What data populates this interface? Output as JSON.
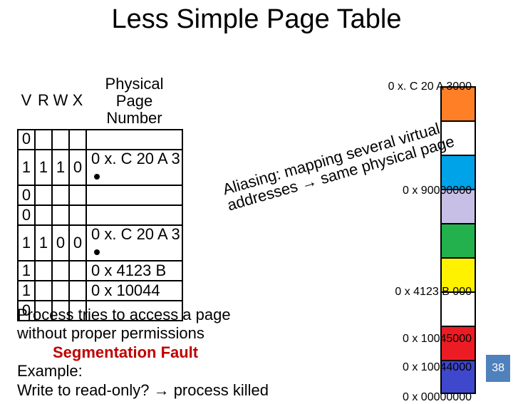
{
  "title": "Less Simple Page Table",
  "table": {
    "headers": {
      "v": "V",
      "r": "R",
      "w": "W",
      "x": "X",
      "ppn_line1": "Physical Page",
      "ppn_line2": "Number"
    },
    "rows": [
      {
        "v": "0",
        "r": "",
        "w": "",
        "x": "",
        "ppn": ""
      },
      {
        "v": "1",
        "r": "1",
        "w": "1",
        "x": "0",
        "ppn": "0 x. C 20 A 3",
        "dot": true
      },
      {
        "v": "0",
        "r": "",
        "w": "",
        "x": "",
        "ppn": ""
      },
      {
        "v": "0",
        "r": "",
        "w": "",
        "x": "",
        "ppn": ""
      },
      {
        "v": "1",
        "r": "1",
        "w": "0",
        "x": "0",
        "ppn": "0 x. C 20 A 3",
        "dot": true
      },
      {
        "v": "1",
        "r": "",
        "w": "",
        "x": "",
        "ppn": "0 x 4123 B"
      },
      {
        "v": "1",
        "r": "",
        "w": "",
        "x": "",
        "ppn": "0 x 10044"
      },
      {
        "v": "0",
        "r": "",
        "w": "",
        "x": "",
        "ppn": ""
      }
    ]
  },
  "memory": {
    "labels": {
      "top": "0 x. C 20 A 3000",
      "second": "0 x 90000000",
      "third": "0 x 4123 B 000",
      "fourth": "0 x 10045000",
      "fifth": "0 x 10044000",
      "bottom": "0 x 00000000"
    },
    "colors": {
      "b0": "#ff7f27",
      "b1": "#ffffff",
      "b2": "#00a2e8",
      "b3": "#c8bfe7",
      "b4": "#22b14c",
      "b5": "#fff200",
      "b6": "#ffffff",
      "b7": "#ed1c24",
      "b8": "#3f48cc"
    }
  },
  "aliasing": {
    "line1": "Aliasing: mapping several virtual",
    "line2": "addresses → same physical page"
  },
  "bottom_text": {
    "l1": "Process tries to access a page",
    "l2": "without proper permissions",
    "segfault": "Segmentation Fault",
    "l3": "Example:",
    "l4a": "Write to read-only? ",
    "l4b": "→ process killed"
  },
  "slide_number": "38"
}
